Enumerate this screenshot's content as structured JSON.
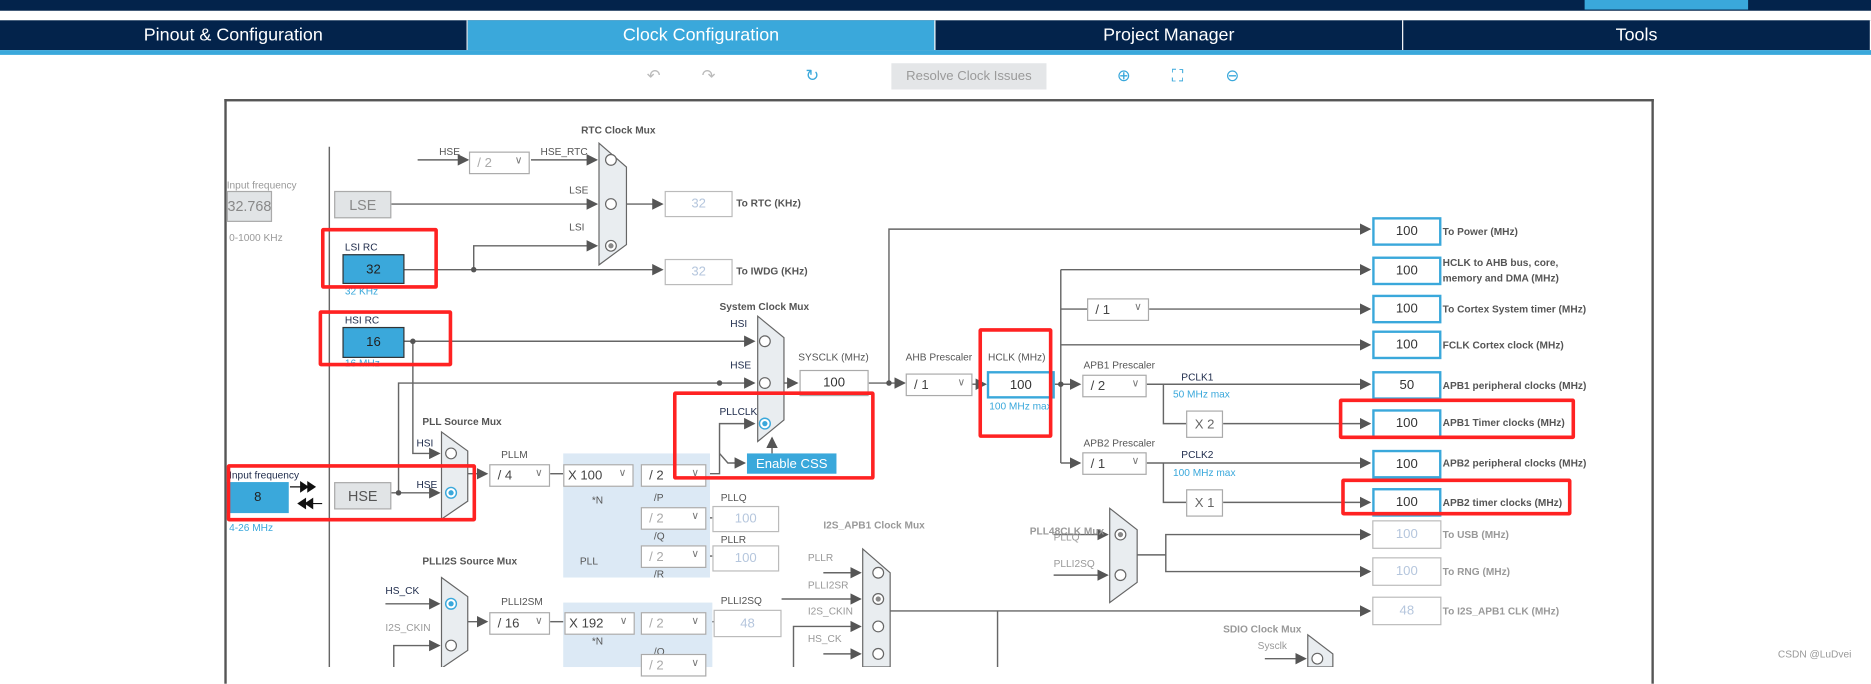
{
  "tabs": [
    {
      "label": "Pinout & Configuration"
    },
    {
      "label": "Clock Configuration",
      "active": true
    },
    {
      "label": "Project Manager"
    },
    {
      "label": "Tools"
    }
  ],
  "toolbar": {
    "undo_icon": "undo-icon",
    "redo_icon": "redo-icon",
    "refresh_icon": "refresh-icon",
    "resolve_label": "Resolve Clock Issues",
    "zoom_in_icon": "zoom-in-icon",
    "fit_icon": "fit-icon",
    "zoom_out_icon": "zoom-out-icon"
  },
  "colors": {
    "brand_dark": "#03234b",
    "accent": "#3aa8db",
    "highlight": "#ff2222"
  },
  "lse": {
    "input_label": "Input frequency",
    "value": "32.768",
    "range": "0-1000 KHz",
    "name": "LSE"
  },
  "rtc": {
    "title": "RTC Clock Mux",
    "hse": "HSE",
    "div": "/ 2",
    "hse_rtc": "HSE_RTC",
    "lse": "LSE",
    "lsi": "LSI",
    "rtc_value": "32",
    "rtc_label": "To RTC (KHz)",
    "iwdg_value": "32",
    "iwdg_label": "To IWDG (KHz)"
  },
  "lsi": {
    "label": "LSI RC",
    "value": "32",
    "sub": "32 KHz"
  },
  "hsi": {
    "label": "HSI RC",
    "value": "16",
    "sub": "16 MHz"
  },
  "sysmux": {
    "title": "System Clock Mux",
    "hsi": "HSI",
    "hse": "HSE",
    "pllclk": "PLLCLK",
    "sysclk_label": "SYSCLK (MHz)",
    "sysclk": "100",
    "enable_css": "Enable CSS"
  },
  "ahb": {
    "prescaler_label": "AHB Prescaler",
    "prescaler": "/ 1",
    "hclk_label": "HCLK (MHz)",
    "hclk": "100",
    "hclk_max": "100 MHz max",
    "cortex_div": "/ 1"
  },
  "apb1": {
    "prescaler_label": "APB1 Prescaler",
    "prescaler": "/ 2",
    "pclk": "PCLK1",
    "max": "50 MHz max",
    "mult": "X 2"
  },
  "apb2": {
    "prescaler_label": "APB2 Prescaler",
    "prescaler": "/ 1",
    "pclk": "PCLK2",
    "max": "100 MHz max",
    "mult": "X 1"
  },
  "outputs": [
    {
      "value": "100",
      "label": "To Power (MHz)"
    },
    {
      "value": "100",
      "label": "HCLK to AHB bus, core,",
      "label2": "memory and DMA (MHz)"
    },
    {
      "value": "100",
      "label": "To Cortex System timer (MHz)"
    },
    {
      "value": "100",
      "label": "FCLK Cortex clock (MHz)"
    },
    {
      "value": "50",
      "label": "APB1 peripheral clocks (MHz)"
    },
    {
      "value": "100",
      "label": "APB1 Timer clocks (MHz)"
    },
    {
      "value": "100",
      "label": "APB2 peripheral clocks (MHz)"
    },
    {
      "value": "100",
      "label": "APB2 timer clocks (MHz)"
    },
    {
      "value": "100",
      "label": "To USB (MHz)"
    },
    {
      "value": "100",
      "label": "To RNG (MHz)"
    },
    {
      "value": "48",
      "label": "To I2S_APB1 CLK (MHz)"
    }
  ],
  "hse": {
    "input_label": "Input frequency",
    "value": "8",
    "range": "4-26 MHz",
    "name": "HSE"
  },
  "pll": {
    "src_title": "PLL Source Mux",
    "hsi": "HSI",
    "hse": "HSE",
    "pllm_label": "PLLM",
    "pllm": "/ 4",
    "n": "X 100",
    "n_label": "*N",
    "p": "/ 2",
    "p_label": "/P",
    "q": "/ 2",
    "q_label": "/Q",
    "r": "/ 2",
    "r_label": "/R",
    "pllq_label": "PLLQ",
    "pllq": "100",
    "pllr_label": "PLLR",
    "pllr": "100",
    "title": "PLL"
  },
  "plli2s": {
    "src_title": "PLLI2S Source Mux",
    "hs_ck": "HS_CK",
    "i2s_ckin": "I2S_CKIN",
    "m_label": "PLLI2SM",
    "m": "/ 16",
    "n": "X 192",
    "n_label": "*N",
    "q": "/ 2",
    "q_label": "/Q",
    "r": "/ 2",
    "q_out_label": "PLLI2SQ",
    "q_out": "48"
  },
  "pll48": {
    "title": "PLL48CLK Mux",
    "pllq": "PLLQ",
    "plli2sq": "PLLI2SQ"
  },
  "i2s": {
    "title": "I2S_APB1 Clock Mux",
    "pllr": "PLLR",
    "plli2sr": "PLLI2SR",
    "i2s_ckin": "I2S_CKIN",
    "hs_ck": "HS_CK"
  },
  "sdio": {
    "title": "SDIO Clock Mux",
    "sysclk": "Sysclk"
  },
  "watermark": "CSDN @LuDvei"
}
